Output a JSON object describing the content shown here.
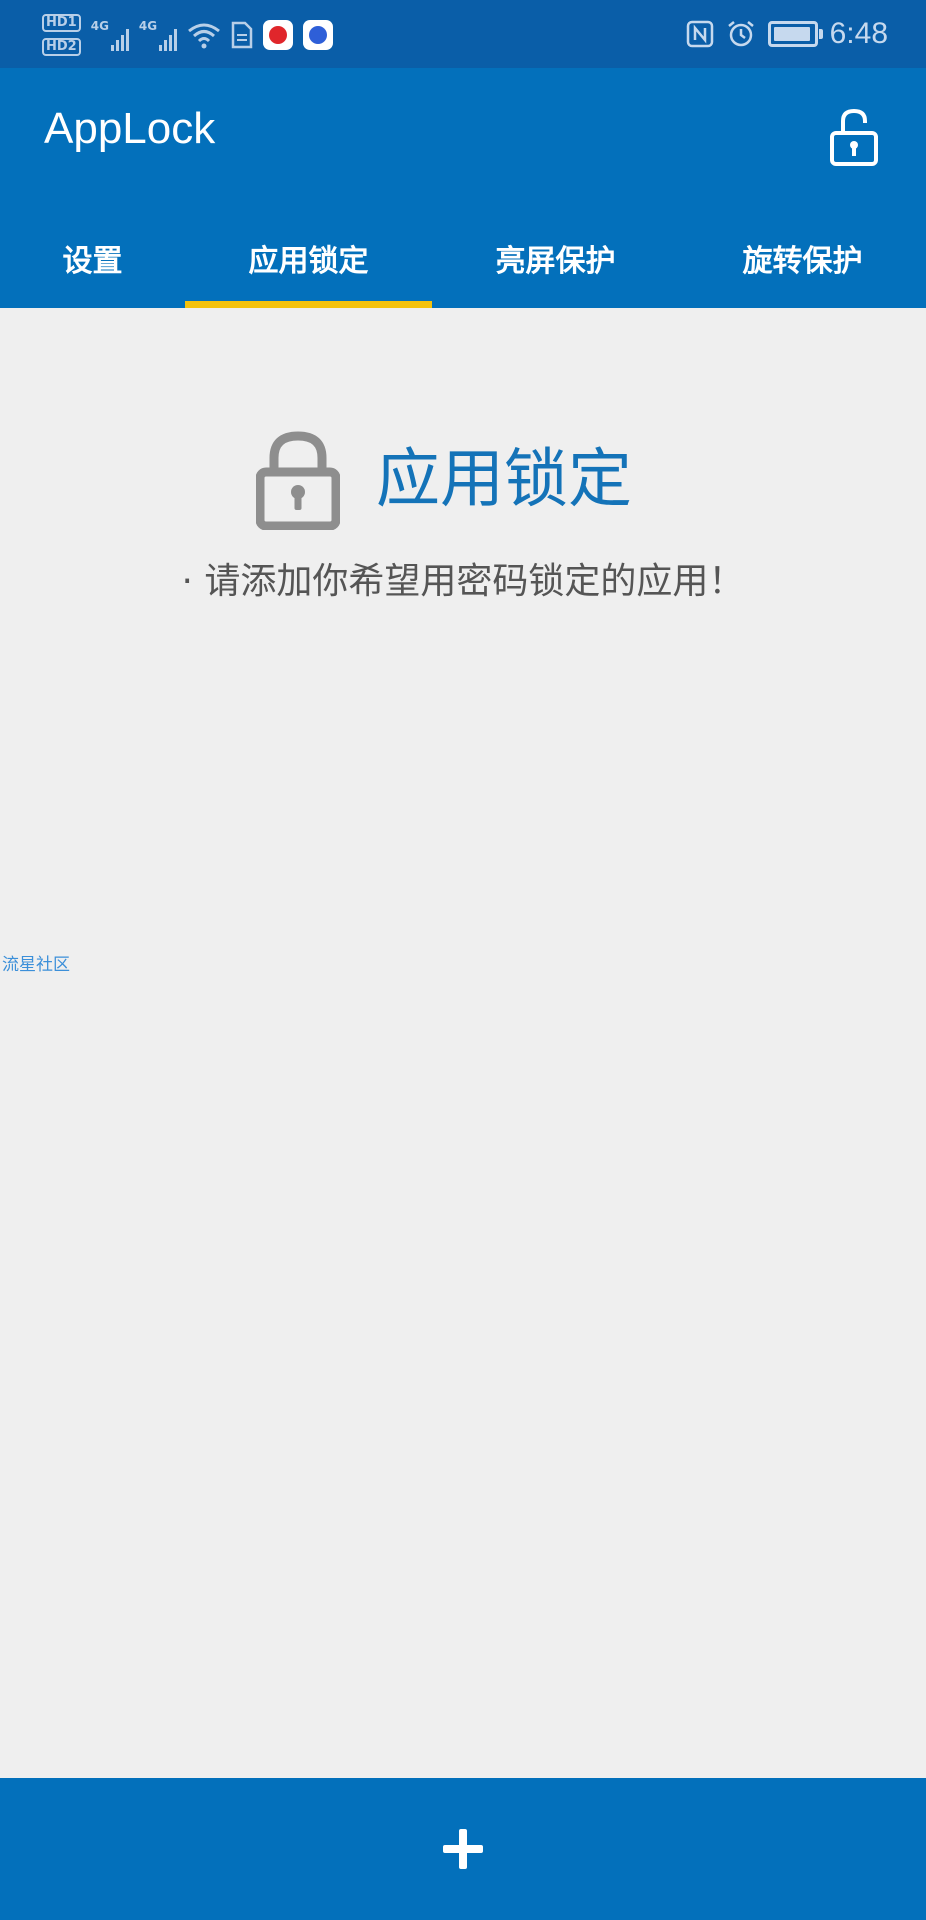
{
  "status_bar": {
    "time": "6:48",
    "network_labels": [
      "4G",
      "4G"
    ],
    "sim_labels": [
      "HD1",
      "HD2"
    ],
    "icons": [
      "hd-icon",
      "signal-icon",
      "wifi-icon",
      "file-icon",
      "app-notification-icon",
      "baidu-icon",
      "nfc-icon",
      "alarm-icon",
      "battery-icon"
    ]
  },
  "app_bar": {
    "title": "AppLock",
    "action_icon": "unlock-icon"
  },
  "tabs": [
    {
      "label": "设置",
      "selected": false
    },
    {
      "label": "应用锁定",
      "selected": true
    },
    {
      "label": "亮屏保护",
      "selected": false
    },
    {
      "label": "旋转保护",
      "selected": false
    }
  ],
  "content": {
    "hero_icon": "padlock-icon",
    "hero_title": "应用锁定",
    "hint": "· 请添加你希望用密码锁定的应用！",
    "watermark": "流星社区"
  },
  "bottom_bar": {
    "action_icon": "plus-icon"
  },
  "colors": {
    "status_bar": "#0a5ea8",
    "primary": "#0370bb",
    "tab_indicator": "#f4c20d",
    "background": "#efefef",
    "hero_title": "#1473b8"
  }
}
